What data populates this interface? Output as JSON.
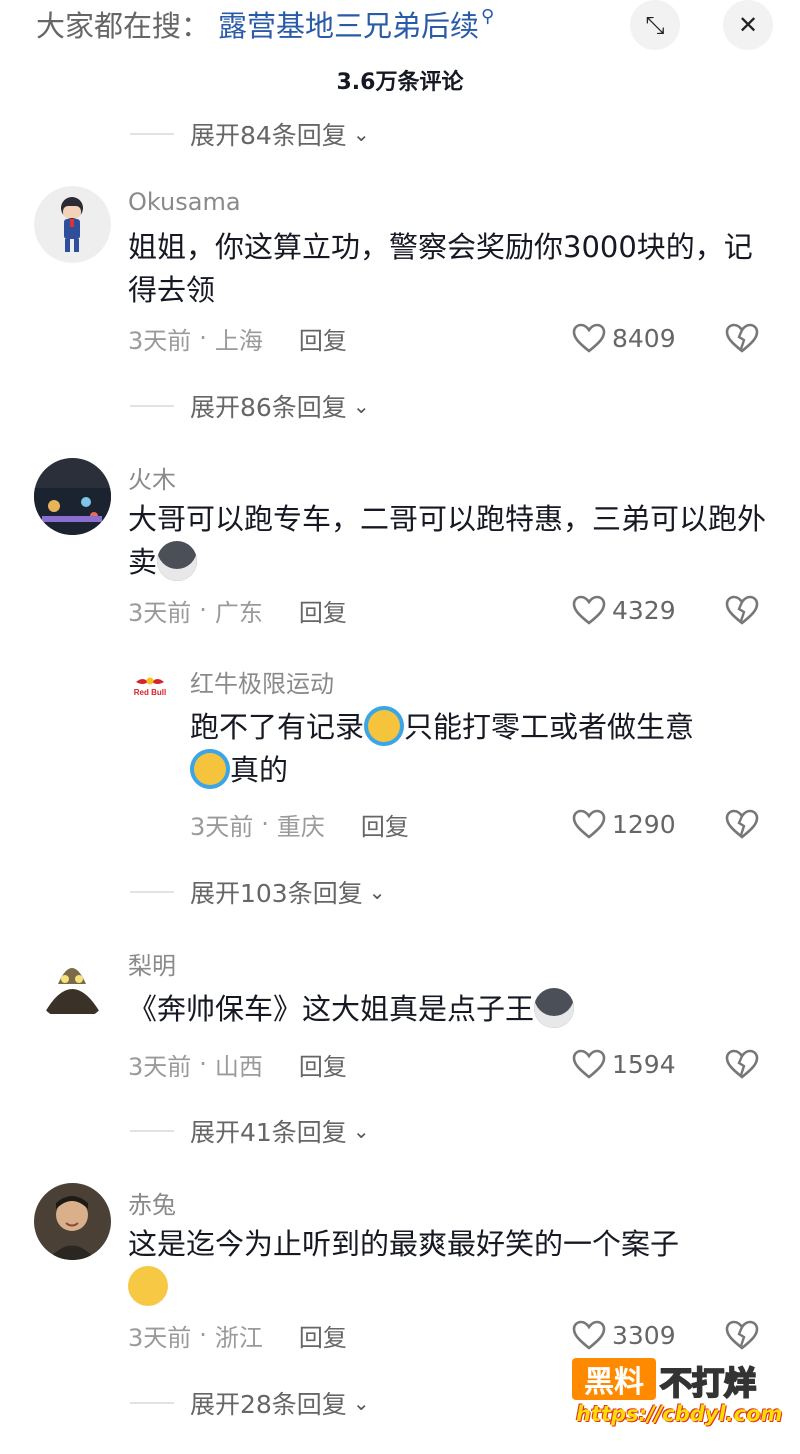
{
  "header": {
    "search_prefix": "大家都在搜：",
    "search_term": "露营基地三兄弟后续",
    "search_glyph": "⚲",
    "shrink_icon": "⤡",
    "close_icon": "✕",
    "comment_count": "3.6万条评论"
  },
  "expand_top": "展开84条回复",
  "comments": [
    {
      "nick": "Okusama",
      "text": "姐姐，你这算立功，警察会奖励你3000块的，记得去领",
      "time": "3天前",
      "location": "上海",
      "reply": "回复",
      "likes": "8409",
      "expand": "展开86条回复"
    },
    {
      "nick": "火木",
      "text": "大哥可以跑专车，二哥可以跑特惠，三弟可以跑外卖",
      "time": "3天前",
      "location": "广东",
      "reply": "回复",
      "likes": "4329",
      "sub": {
        "nick": "红牛极限运动",
        "avatar_text": "Red Bull",
        "text_a": "跑不了有记录",
        "text_b": "只能打零工或者做生意",
        "text_c": "真的",
        "time": "3天前",
        "location": "重庆",
        "reply": "回复",
        "likes": "1290"
      },
      "expand": "展开103条回复"
    },
    {
      "nick": "梨明",
      "text": "《奔帅保车》这大姐真是点子王",
      "time": "3天前",
      "location": "山西",
      "reply": "回复",
      "likes": "1594",
      "expand": "展开41条回复"
    },
    {
      "nick": "赤兔",
      "text": "这是迄今为止听到的最爽最好笑的一个案子",
      "time": "3天前",
      "location": "浙江",
      "reply": "回复",
      "likes": "3309",
      "expand": "展开28条回复"
    }
  ],
  "meta_sep": "·",
  "expand_chevron": "⌄",
  "watermark": {
    "box": "黑料",
    "text": "不打烊",
    "url": "https://cbdyl.com"
  },
  "colors": {
    "search_link": "#2a5ba8",
    "watermark_orange": "#ff8a00"
  }
}
